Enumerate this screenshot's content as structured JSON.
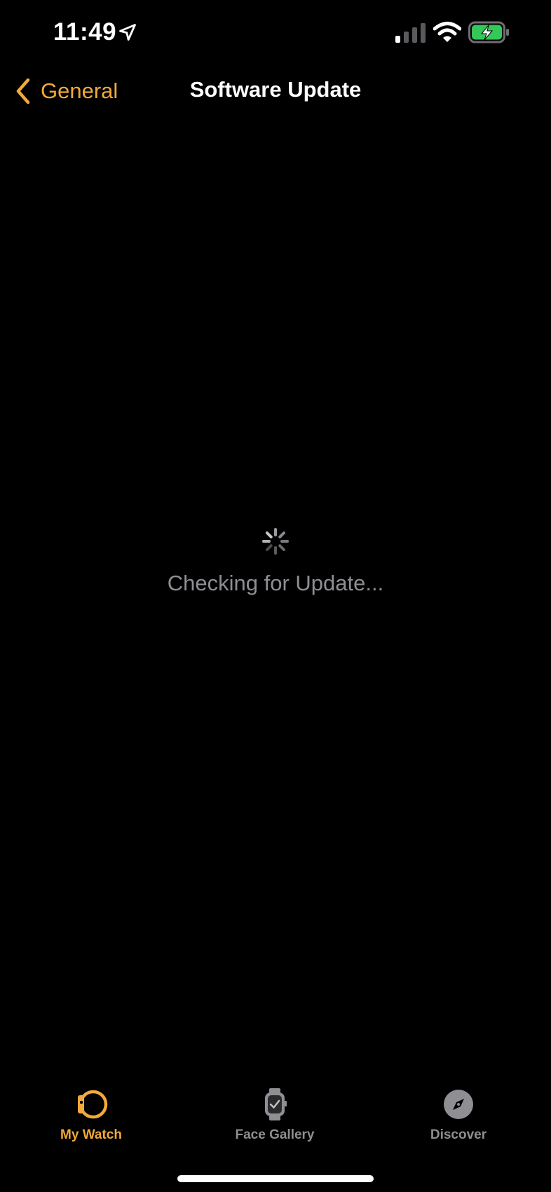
{
  "status_bar": {
    "time": "11:49",
    "icons": [
      "location-arrow-icon",
      "cellular-signal-icon",
      "wifi-icon",
      "battery-charging-icon"
    ]
  },
  "nav": {
    "back_label": "General",
    "title": "Software Update"
  },
  "content": {
    "loading_text": "Checking for Update..."
  },
  "tabs": [
    {
      "label": "My Watch",
      "icon": "watch-side-icon",
      "active": true
    },
    {
      "label": "Face Gallery",
      "icon": "watch-face-icon",
      "active": false
    },
    {
      "label": "Discover",
      "icon": "compass-icon",
      "active": false
    }
  ],
  "colors": {
    "accent": "#f2a93b",
    "inactive": "#8e8e93",
    "battery": "#34c759",
    "background": "#000000"
  }
}
